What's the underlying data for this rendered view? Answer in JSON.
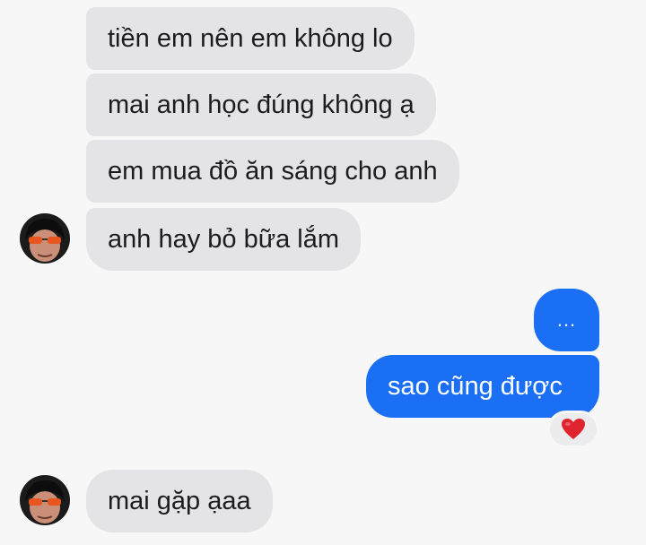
{
  "conversation": {
    "incoming_group_1": [
      {
        "text": "tiền em nên em không lo"
      },
      {
        "text": "mai anh học đúng không ạ"
      },
      {
        "text": "em mua đồ ăn sáng cho anh"
      },
      {
        "text": "anh hay bỏ bữa lắm"
      }
    ],
    "outgoing": [
      {
        "text": "..."
      },
      {
        "text": "sao cũng được",
        "reaction": "red-heart-icon"
      }
    ],
    "incoming_group_2": [
      {
        "text": "mai gặp ạaa"
      }
    ]
  },
  "colors": {
    "incoming_bubble": "#e4e4e6",
    "outgoing_bubble": "#1a6ff5",
    "background": "#f7f7f8",
    "heart": "#e0242f"
  }
}
